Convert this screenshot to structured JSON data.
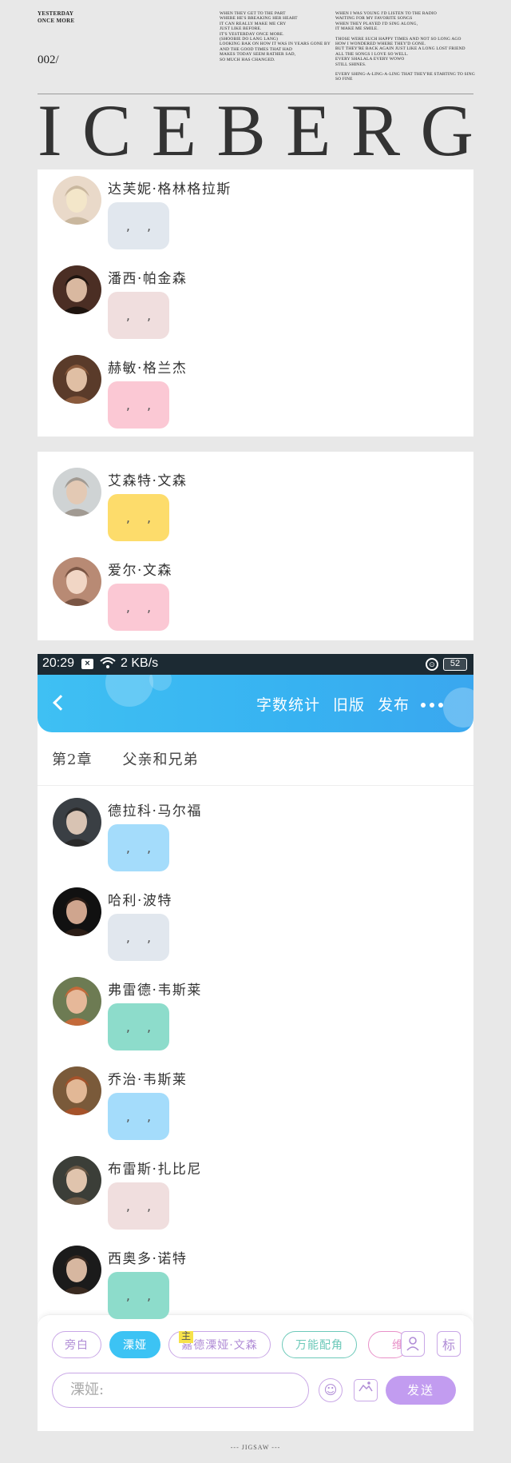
{
  "poster": {
    "tag_line1": "YESTERDAY",
    "tag_line2": "ONCE MORE",
    "issue": "002/",
    "lyrics_mid": [
      "WHEN THEY GET TO THE PART\nWHERE HE'S BREAKING HER HEART\nIT CAN REALLY MAKE ME CRY\nJUST LIKE BEFORE.\nIT'S YESTERDAY ONCE MORE.\n(SHOOBIE DO LANG LANG)\nLOOKING BAK ON HOW IT WAS IN YEARS GONE BY\nAND THE GOOD TIMES THAT HAD\nMAKES TODAY SEEM RATHER SAD,\nSO MUCH HAS CHANGED."
    ],
    "lyrics_right": [
      "WHEN I WAS YOUNG I'D LISTEN TO THE RADIO\nWAITING FOR MY FAVORITE SONGS\nWHEN THEY PLAYED I'D SING ALONG,\nIT MAKE ME SMILE.",
      "THOSE WERE SUCH HAPPY TIMES AND NOT SO LONG AGO\nHOW I WONDERED WHERE THEY'D GONE.\nBUT THEY'RE BACK AGAIN JUST LIKE A LONG LOST FRIEND\nALL THE SONGS I LOVE SO WELL.\nEVERY SHALALA EVERY WOWO\nSTILL SHINES.",
      "EVERY SHING-A-LING-A-LING THAT THEY'RE STARTING TO SING\nSO FINE"
    ],
    "title": "ICEBERG"
  },
  "panel1": [
    {
      "name": "达芙妮·格林格拉斯",
      "bubble": ", ,",
      "bubble_color": "#e1e7ee"
    },
    {
      "name": "潘西·帕金森",
      "bubble": ", ,",
      "bubble_color": "#f0dede"
    },
    {
      "name": "赫敏·格兰杰",
      "bubble": ", ,",
      "bubble_color": "#fbc8d4"
    }
  ],
  "panel2": [
    {
      "name": "艾森特·文森",
      "bubble": ", ,",
      "bubble_color": "#fddc6b"
    },
    {
      "name": "爱尔·文森",
      "bubble": ", ,",
      "bubble_color": "#fbc8d4"
    }
  ],
  "statusbar": {
    "time": "20:29",
    "speed": "2 KB/s",
    "battery": "52"
  },
  "appbar": {
    "actions": [
      "字数统计",
      "旧版",
      "发布"
    ]
  },
  "chapter": {
    "number": "第2章",
    "title": "父亲和兄弟"
  },
  "panel3": [
    {
      "name": "德拉科·马尔福",
      "bubble": ", ,",
      "bubble_color": "#a4dcfb"
    },
    {
      "name": "哈利·波特",
      "bubble": ", ,",
      "bubble_color": "#e1e7ee"
    },
    {
      "name": "弗雷德·韦斯莱",
      "bubble": ", ,",
      "bubble_color": "#8ddccb"
    },
    {
      "name": "乔治·韦斯莱",
      "bubble": ", ,",
      "bubble_color": "#a4dcfb"
    },
    {
      "name": "布雷斯·扎比尼",
      "bubble": ", ,",
      "bubble_color": "#f0dede"
    },
    {
      "name": "西奥多·诺特",
      "bubble": ", ,",
      "bubble_color": "#8ddccb"
    }
  ],
  "composer": {
    "chips": [
      "旁白",
      "溧娅",
      "嘉德溧娅·文森",
      "万能配角",
      "维"
    ],
    "main_tag": "主",
    "person_icon": "person-icon",
    "tag_button": "标",
    "input_placeholder": "溧娅:",
    "send_label": "发送"
  },
  "footer": "---  JIGSAW  ---"
}
